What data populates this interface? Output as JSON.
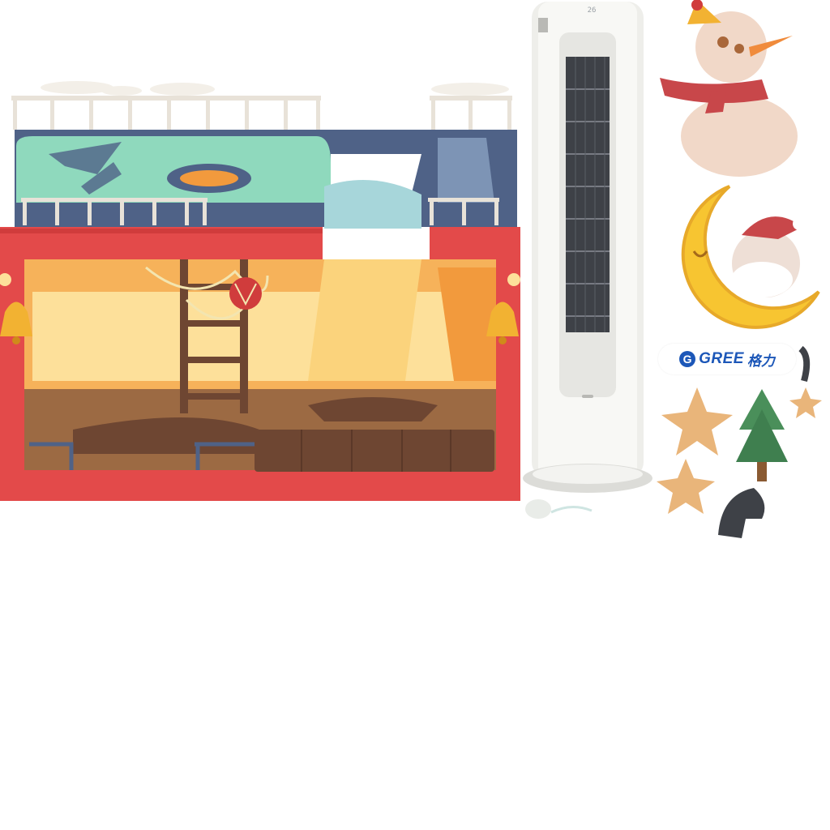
{
  "brand": {
    "logo_letter": "G",
    "name": "GREE",
    "cn_name": "格力"
  },
  "ac_unit": {
    "display_reading": "26"
  },
  "icons": [
    "house-scene",
    "tower-air-conditioner",
    "snowman-icon",
    "moon-icon",
    "santa-icon",
    "star-icon",
    "tree-icon",
    "bell-icon"
  ],
  "colors": {
    "house_red": "#e34a4a",
    "house_teal": "#8fd9bd",
    "warm_light": "#f6b25a",
    "brand_blue": "#1c57b8",
    "moon_yellow": "#f7c531"
  }
}
